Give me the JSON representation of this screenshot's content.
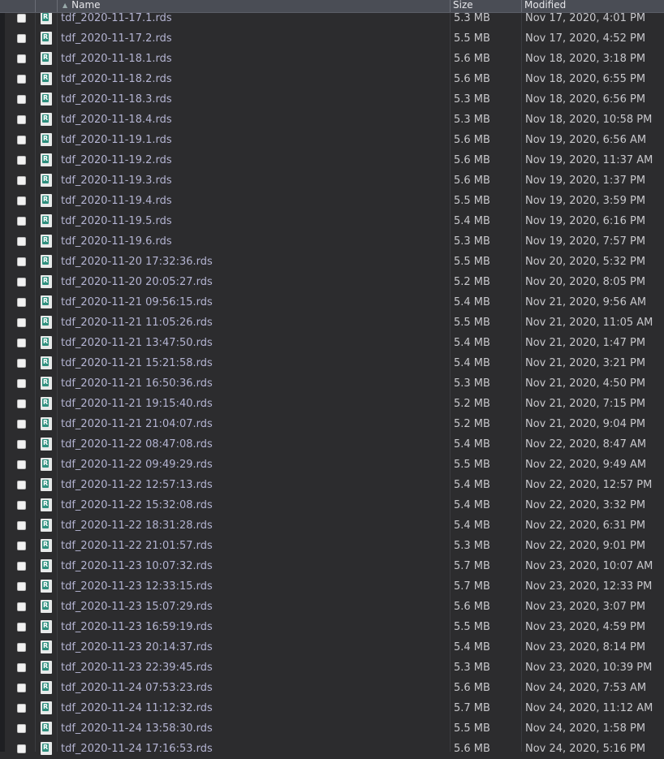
{
  "header": {
    "name": "Name",
    "size": "Size",
    "modified": "Modified"
  },
  "files": [
    {
      "name": "tdf_2020-11-17.1.rds",
      "size": "5.3 MB",
      "modified": "Nov 17, 2020, 4:01 PM"
    },
    {
      "name": "tdf_2020-11-17.2.rds",
      "size": "5.5 MB",
      "modified": "Nov 17, 2020, 4:52 PM"
    },
    {
      "name": "tdf_2020-11-18.1.rds",
      "size": "5.6 MB",
      "modified": "Nov 18, 2020, 3:18 PM"
    },
    {
      "name": "tdf_2020-11-18.2.rds",
      "size": "5.6 MB",
      "modified": "Nov 18, 2020, 6:55 PM"
    },
    {
      "name": "tdf_2020-11-18.3.rds",
      "size": "5.3 MB",
      "modified": "Nov 18, 2020, 6:56 PM"
    },
    {
      "name": "tdf_2020-11-18.4.rds",
      "size": "5.3 MB",
      "modified": "Nov 18, 2020, 10:58 PM"
    },
    {
      "name": "tdf_2020-11-19.1.rds",
      "size": "5.6 MB",
      "modified": "Nov 19, 2020, 6:56 AM"
    },
    {
      "name": "tdf_2020-11-19.2.rds",
      "size": "5.6 MB",
      "modified": "Nov 19, 2020, 11:37 AM"
    },
    {
      "name": "tdf_2020-11-19.3.rds",
      "size": "5.6 MB",
      "modified": "Nov 19, 2020, 1:37 PM"
    },
    {
      "name": "tdf_2020-11-19.4.rds",
      "size": "5.5 MB",
      "modified": "Nov 19, 2020, 3:59 PM"
    },
    {
      "name": "tdf_2020-11-19.5.rds",
      "size": "5.4 MB",
      "modified": "Nov 19, 2020, 6:16 PM"
    },
    {
      "name": "tdf_2020-11-19.6.rds",
      "size": "5.3 MB",
      "modified": "Nov 19, 2020, 7:57 PM"
    },
    {
      "name": "tdf_2020-11-20 17:32:36.rds",
      "size": "5.5 MB",
      "modified": "Nov 20, 2020, 5:32 PM"
    },
    {
      "name": "tdf_2020-11-20 20:05:27.rds",
      "size": "5.2 MB",
      "modified": "Nov 20, 2020, 8:05 PM"
    },
    {
      "name": "tdf_2020-11-21 09:56:15.rds",
      "size": "5.4 MB",
      "modified": "Nov 21, 2020, 9:56 AM"
    },
    {
      "name": "tdf_2020-11-21 11:05:26.rds",
      "size": "5.5 MB",
      "modified": "Nov 21, 2020, 11:05 AM"
    },
    {
      "name": "tdf_2020-11-21 13:47:50.rds",
      "size": "5.4 MB",
      "modified": "Nov 21, 2020, 1:47 PM"
    },
    {
      "name": "tdf_2020-11-21 15:21:58.rds",
      "size": "5.4 MB",
      "modified": "Nov 21, 2020, 3:21 PM"
    },
    {
      "name": "tdf_2020-11-21 16:50:36.rds",
      "size": "5.3 MB",
      "modified": "Nov 21, 2020, 4:50 PM"
    },
    {
      "name": "tdf_2020-11-21 19:15:40.rds",
      "size": "5.2 MB",
      "modified": "Nov 21, 2020, 7:15 PM"
    },
    {
      "name": "tdf_2020-11-21 21:04:07.rds",
      "size": "5.2 MB",
      "modified": "Nov 21, 2020, 9:04 PM"
    },
    {
      "name": "tdf_2020-11-22 08:47:08.rds",
      "size": "5.4 MB",
      "modified": "Nov 22, 2020, 8:47 AM"
    },
    {
      "name": "tdf_2020-11-22 09:49:29.rds",
      "size": "5.5 MB",
      "modified": "Nov 22, 2020, 9:49 AM"
    },
    {
      "name": "tdf_2020-11-22 12:57:13.rds",
      "size": "5.4 MB",
      "modified": "Nov 22, 2020, 12:57 PM"
    },
    {
      "name": "tdf_2020-11-22 15:32:08.rds",
      "size": "5.4 MB",
      "modified": "Nov 22, 2020, 3:32 PM"
    },
    {
      "name": "tdf_2020-11-22 18:31:28.rds",
      "size": "5.4 MB",
      "modified": "Nov 22, 2020, 6:31 PM"
    },
    {
      "name": "tdf_2020-11-22 21:01:57.rds",
      "size": "5.3 MB",
      "modified": "Nov 22, 2020, 9:01 PM"
    },
    {
      "name": "tdf_2020-11-23 10:07:32.rds",
      "size": "5.7 MB",
      "modified": "Nov 23, 2020, 10:07 AM"
    },
    {
      "name": "tdf_2020-11-23 12:33:15.rds",
      "size": "5.7 MB",
      "modified": "Nov 23, 2020, 12:33 PM"
    },
    {
      "name": "tdf_2020-11-23 15:07:29.rds",
      "size": "5.6 MB",
      "modified": "Nov 23, 2020, 3:07 PM"
    },
    {
      "name": "tdf_2020-11-23 16:59:19.rds",
      "size": "5.5 MB",
      "modified": "Nov 23, 2020, 4:59 PM"
    },
    {
      "name": "tdf_2020-11-23 20:14:37.rds",
      "size": "5.4 MB",
      "modified": "Nov 23, 2020, 8:14 PM"
    },
    {
      "name": "tdf_2020-11-23 22:39:45.rds",
      "size": "5.3 MB",
      "modified": "Nov 23, 2020, 10:39 PM"
    },
    {
      "name": "tdf_2020-11-24 07:53:23.rds",
      "size": "5.6 MB",
      "modified": "Nov 24, 2020, 7:53 AM"
    },
    {
      "name": "tdf_2020-11-24 11:12:32.rds",
      "size": "5.7 MB",
      "modified": "Nov 24, 2020, 11:12 AM"
    },
    {
      "name": "tdf_2020-11-24 13:58:30.rds",
      "size": "5.5 MB",
      "modified": "Nov 24, 2020, 1:58 PM"
    },
    {
      "name": "tdf_2020-11-24 17:16:53.rds",
      "size": "5.6 MB",
      "modified": "Nov 24, 2020, 5:16 PM"
    }
  ],
  "icons": {
    "file": "r-data-file-icon",
    "sort": "sort-ascending-icon",
    "checkbox": "checkbox-icon"
  }
}
